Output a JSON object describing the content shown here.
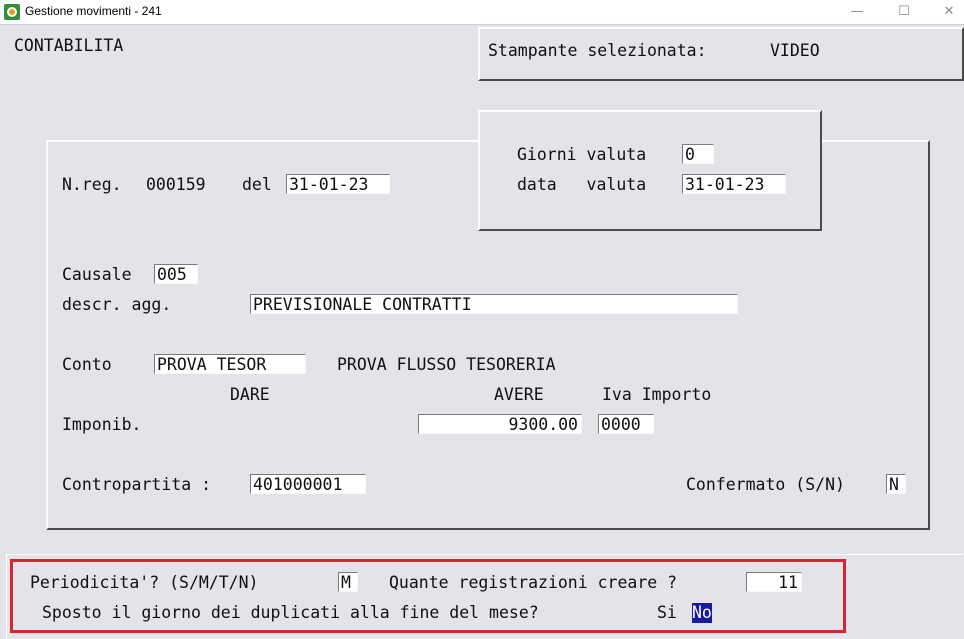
{
  "window": {
    "title": "Gestione movimenti - 241",
    "minimize": "—",
    "maximize": "☐",
    "close": "✕",
    "icon": "app-icon"
  },
  "header": {
    "section": "CONTABILITA",
    "printer_label": "Stampante selezionata:",
    "printer_value": "VIDEO"
  },
  "valuta": {
    "giorni_label": "Giorni valuta",
    "giorni_value": "0",
    "data_label": "data   valuta",
    "data_value": "31-01-23"
  },
  "registration": {
    "nreg_label": "N.reg.",
    "nreg_value": "000159",
    "del_label": "del",
    "date_value": "31-01-23"
  },
  "causale": {
    "label": "Causale",
    "value": "005",
    "descr_label": "descr. agg.",
    "descr_value": "PREVISIONALE CONTRATTI"
  },
  "conto": {
    "label": "Conto",
    "value": "PROVA TESOR",
    "description": "PROVA FLUSSO TESORERIA",
    "dare_label": "DARE",
    "avere_label": "AVERE",
    "iva_label": "Iva Importo",
    "imponib_label": "Imponib.",
    "avere_value": "9300.00",
    "iva_value": "0000"
  },
  "contropartita": {
    "label": "Contropartita :",
    "value": "401000001",
    "confermato_label": "Confermato (S/N)",
    "confermato_value": "N"
  },
  "bottom": {
    "periodicita_label": "Periodicita'? (S/M/T/N)",
    "periodicita_value": "M",
    "quante_label": "Quante registrazioni creare ?",
    "quante_value": "11",
    "sposto_label": "Sposto il giorno dei duplicati alla fine del mese?",
    "option_si": "Si",
    "option_no": "No"
  }
}
